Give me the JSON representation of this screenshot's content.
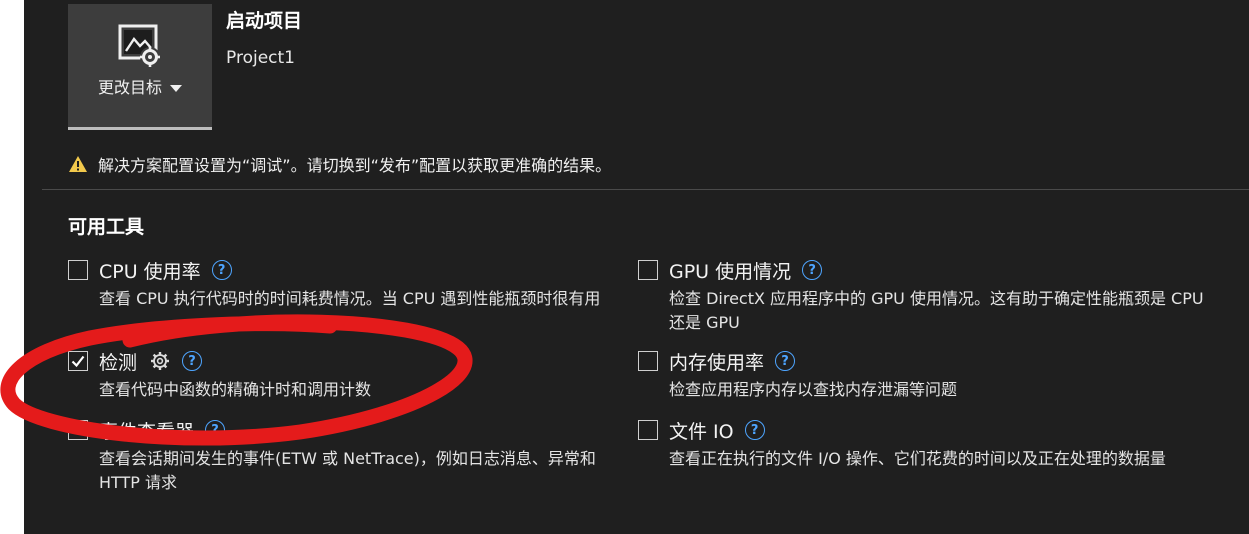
{
  "startup": {
    "change_target_label": "更改目标",
    "title": "启动项目",
    "project": "Project1"
  },
  "warning": {
    "icon": "warning-icon",
    "text": "解决方案配置设置为“调试”。请切换到“发布”配置以获取更准确的结果。"
  },
  "tools": {
    "title": "可用工具",
    "items": [
      {
        "name": "CPU 使用率",
        "checked": false,
        "desc": "查看 CPU 执行代码时的时间耗费情况。当 CPU 遇到性能瓶颈时很有用"
      },
      {
        "name": "GPU 使用情况",
        "checked": false,
        "desc": "检查 DirectX 应用程序中的 GPU 使用情况。这有助于确定性能瓶颈是 CPU 还是 GPU"
      },
      {
        "name": "检测",
        "checked": true,
        "desc": "查看代码中函数的精确计时和调用计数"
      },
      {
        "name": "内存使用率",
        "checked": false,
        "desc": "检查应用程序内存以查找内存泄漏等问题"
      },
      {
        "name": "事件查看器",
        "checked": false,
        "desc": "查看会话期间发生的事件(ETW 或 NetTrace)，例如日志消息、异常和 HTTP 请求"
      },
      {
        "name": "文件 IO",
        "checked": false,
        "desc": "查看正在执行的文件 I/O 操作、它们花费的时间以及正在处理的数据量"
      }
    ]
  },
  "colors": {
    "background": "#1f1f1f",
    "help_accent": "#4ea5ff",
    "annotation": "#e41b1b"
  }
}
